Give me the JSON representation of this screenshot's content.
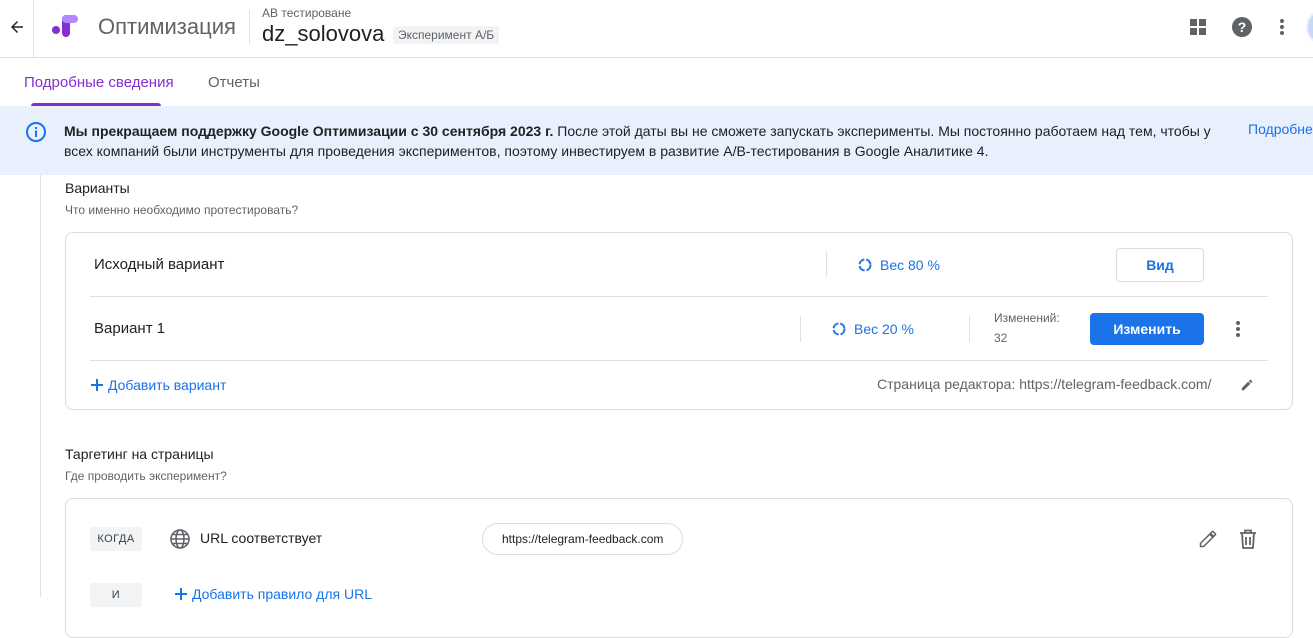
{
  "header": {
    "back_icon": "arrow-back-icon",
    "app_title": "Оптимизация",
    "account": "AB тестироване",
    "experiment_name": "dz_solovova",
    "experiment_type": "Эксперимент А/Б",
    "icons": [
      "apps-icon",
      "help-icon",
      "more-vert-icon"
    ]
  },
  "tabs": [
    {
      "label": "Подробные сведения",
      "active": true
    },
    {
      "label": "Отчеты",
      "active": false
    }
  ],
  "banner": {
    "bold_text": "Мы прекращаем поддержку Google Оптимизации с 30 сентября 2023 г.",
    "text": " После этой даты вы не сможете запускать эксперименты. Мы постоянно работаем над тем, чтобы у всех компаний были инструменты для проведения экспериментов, поэтому инвестируем в развитие A/B-тестирования в Google Аналитике 4.",
    "link": "Подробнее"
  },
  "variants": {
    "title": "Варианты",
    "subtitle": "Что именно необходимо протестировать?",
    "original": {
      "name": "Исходный вариант",
      "weight": "Вес 80 %",
      "button": "Вид"
    },
    "variant1": {
      "name": "Вариант 1",
      "weight": "Вес 20 %",
      "changes_label": "Изменений:",
      "changes_count": "32",
      "button": "Изменить"
    },
    "add_variant": "Добавить вариант",
    "editor_page": "Страница редактора: https://telegram-feedback.com/"
  },
  "targeting": {
    "title": "Таргетинг на страницы",
    "subtitle": "Где проводить эксперимент?",
    "when_chip": "КОГДА",
    "rule_label": "URL соответствует",
    "rule_value": "https://telegram-feedback.com",
    "and_chip": "И",
    "add_rule": "Добавить правило для URL"
  },
  "colors": {
    "accent": "#8430ce",
    "link": "#1a73e8",
    "banner_bg": "#e8f0fe"
  }
}
